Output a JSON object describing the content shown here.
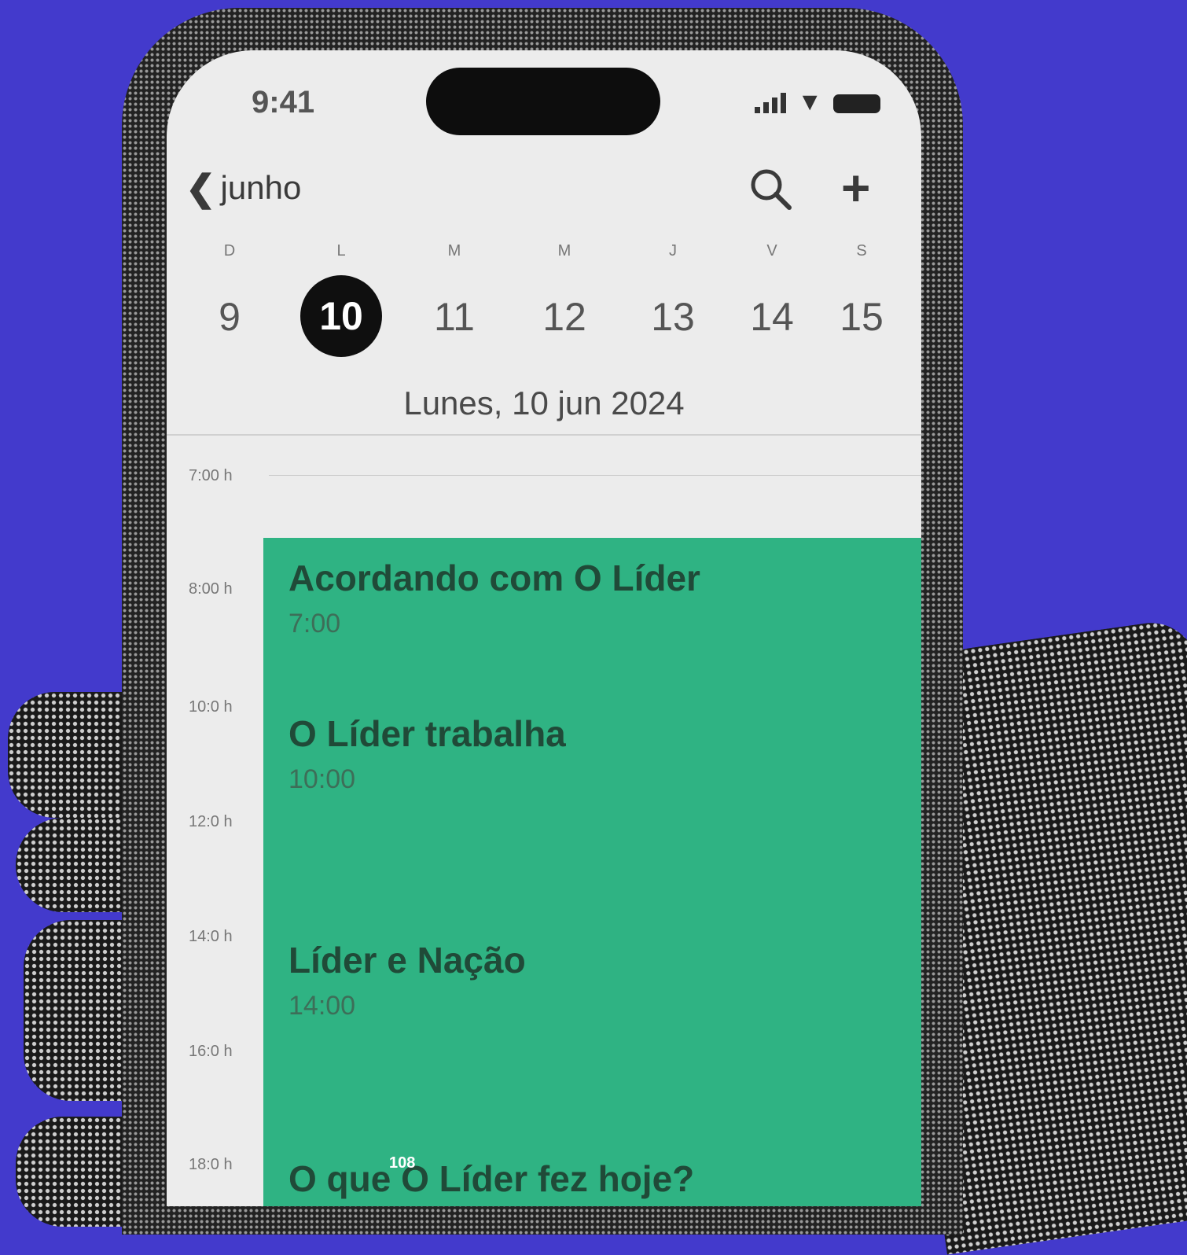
{
  "status_bar": {
    "time": "9:41",
    "signal_icon": "signal-icon",
    "wifi_icon": "wifi-icon",
    "battery_icon": "battery-icon"
  },
  "header": {
    "back_label": "junho",
    "search_icon": "search-icon",
    "add_icon": "plus-icon"
  },
  "week": {
    "letters": [
      "D",
      "L",
      "M",
      "M",
      "J",
      "V",
      "S"
    ],
    "days": [
      "9",
      "10",
      "11",
      "12",
      "13",
      "14",
      "15"
    ],
    "selected": "10"
  },
  "date_title": "Lunes, 10 jun 2024",
  "hours": [
    "7:00 h",
    "8:00 h",
    "10:0 h",
    "12:0 h",
    "14:0 h",
    "16:0 h",
    "18:0 h"
  ],
  "events": [
    {
      "title": "Acordando com O Líder",
      "time": "7:00"
    },
    {
      "title": "O Líder trabalha",
      "time": "10:00"
    },
    {
      "title": "Líder e Nação",
      "time": "14:00"
    },
    {
      "title": "O que O Líder fez hoje?",
      "time": ""
    }
  ],
  "colors": {
    "background": "#433acc",
    "event_green": "#2fb383",
    "selected_day": "#0f0f0f"
  },
  "page_number": "108"
}
